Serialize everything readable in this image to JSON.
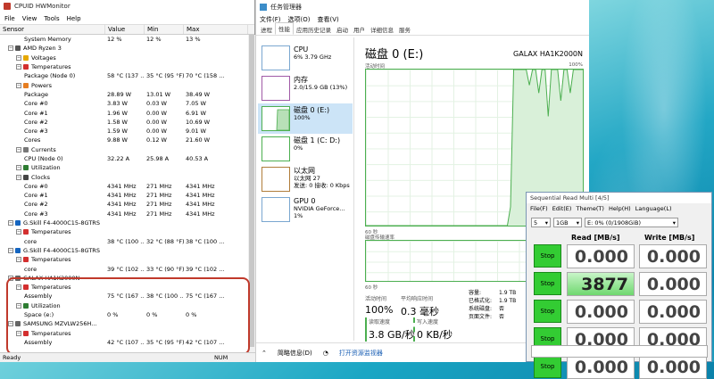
{
  "hwmonitor": {
    "title": "CPUID HWMonitor",
    "menu": [
      "File",
      "View",
      "Tools",
      "Help"
    ],
    "columns": [
      "Sensor",
      "Value",
      "Min",
      "Max"
    ],
    "rows": [
      {
        "indent": 3,
        "label": "System Memory",
        "value": "12 %",
        "min": "12 %",
        "max": "13 %"
      },
      {
        "indent": 1,
        "label": "AMD Ryzen 3",
        "icon": "chip",
        "value": "",
        "min": "",
        "max": ""
      },
      {
        "indent": 2,
        "label": "Voltages",
        "icon": "volt",
        "value": "",
        "min": "",
        "max": ""
      },
      {
        "indent": 2,
        "label": "Temperatures",
        "icon": "temp",
        "value": "",
        "min": "",
        "max": ""
      },
      {
        "indent": 3,
        "label": "Package (Node 0)",
        "value": "58 °C (137 ...",
        "min": "35 °C (95 °F)",
        "max": "70 °C (158 ..."
      },
      {
        "indent": 2,
        "label": "Powers",
        "icon": "power",
        "value": "",
        "min": "",
        "max": ""
      },
      {
        "indent": 3,
        "label": "Package",
        "value": "28.89 W",
        "min": "13.01 W",
        "max": "38.49 W"
      },
      {
        "indent": 3,
        "label": "Core #0",
        "value": "3.83 W",
        "min": "0.03 W",
        "max": "7.05 W"
      },
      {
        "indent": 3,
        "label": "Core #1",
        "value": "1.96 W",
        "min": "0.00 W",
        "max": "6.91 W"
      },
      {
        "indent": 3,
        "label": "Core #2",
        "value": "1.58 W",
        "min": "0.00 W",
        "max": "10.69 W"
      },
      {
        "indent": 3,
        "label": "Core #3",
        "value": "1.59 W",
        "min": "0.00 W",
        "max": "9.01 W"
      },
      {
        "indent": 3,
        "label": "Cores",
        "value": "9.88 W",
        "min": "0.12 W",
        "max": "21.60 W"
      },
      {
        "indent": 2,
        "label": "Currents",
        "icon": "current",
        "value": "",
        "min": "",
        "max": ""
      },
      {
        "indent": 3,
        "label": "CPU (Node 0)",
        "value": "32.22 A",
        "min": "25.98 A",
        "max": "40.53 A"
      },
      {
        "indent": 2,
        "label": "Utilization",
        "icon": "util",
        "value": "",
        "min": "",
        "max": ""
      },
      {
        "indent": 2,
        "label": "Clocks",
        "icon": "clock",
        "value": "",
        "min": "",
        "max": ""
      },
      {
        "indent": 3,
        "label": "Core #0",
        "value": "4341 MHz",
        "min": "271 MHz",
        "max": "4341 MHz"
      },
      {
        "indent": 3,
        "label": "Core #1",
        "value": "4341 MHz",
        "min": "271 MHz",
        "max": "4341 MHz"
      },
      {
        "indent": 3,
        "label": "Core #2",
        "value": "4341 MHz",
        "min": "271 MHz",
        "max": "4341 MHz"
      },
      {
        "indent": 3,
        "label": "Core #3",
        "value": "4341 MHz",
        "min": "271 MHz",
        "max": "4341 MHz"
      },
      {
        "indent": 1,
        "label": "G.Skill F4-4000C15-8GTRS",
        "icon": "ram",
        "value": "",
        "min": "",
        "max": ""
      },
      {
        "indent": 2,
        "label": "Temperatures",
        "icon": "temp",
        "value": "",
        "min": "",
        "max": ""
      },
      {
        "indent": 3,
        "label": "core",
        "value": "38 °C (100 ...",
        "min": "32 °C (88 °F)",
        "max": "38 °C (100 ..."
      },
      {
        "indent": 1,
        "label": "G.Skill F4-4000C15-8GTRS",
        "icon": "ram",
        "value": "",
        "min": "",
        "max": ""
      },
      {
        "indent": 2,
        "label": "Temperatures",
        "icon": "temp",
        "value": "",
        "min": "",
        "max": ""
      },
      {
        "indent": 3,
        "label": "core",
        "value": "39 °C (102 ...",
        "min": "33 °C (90 °F)",
        "max": "39 °C (102 ..."
      },
      {
        "indent": 1,
        "label": "GALAX HA1K2000N",
        "icon": "disk",
        "value": "",
        "min": "",
        "max": ""
      },
      {
        "indent": 2,
        "label": "Temperatures",
        "icon": "temp",
        "value": "",
        "min": "",
        "max": ""
      },
      {
        "indent": 3,
        "label": "Assembly",
        "value": "75 °C (167 ...",
        "min": "38 °C (100 ...",
        "max": "75 °C (167 ..."
      },
      {
        "indent": 2,
        "label": "Utilization",
        "icon": "util",
        "value": "",
        "min": "",
        "max": ""
      },
      {
        "indent": 3,
        "label": "Space (e:)",
        "value": "0 %",
        "min": "0 %",
        "max": "0 %"
      },
      {
        "indent": 1,
        "label": "SAMSUNG MZVLW256H...",
        "icon": "disk",
        "value": "",
        "min": "",
        "max": ""
      },
      {
        "indent": 2,
        "label": "Temperatures",
        "icon": "temp",
        "value": "",
        "min": "",
        "max": ""
      },
      {
        "indent": 3,
        "label": "Assembly",
        "value": "42 °C (107 ...",
        "min": "35 °C (95 °F)",
        "max": "42 °C (107 ..."
      }
    ],
    "status_left": "Ready",
    "status_right": "NUM"
  },
  "taskmgr": {
    "title": "任务管理器",
    "menu": [
      "文件(F)",
      "选项(O)",
      "查看(V)"
    ],
    "tabs": [
      "进程",
      "性能",
      "应用历史记录",
      "启动",
      "用户",
      "详细信息",
      "服务"
    ],
    "active_tab": 1,
    "items": [
      {
        "name": "CPU",
        "line1": "6% 3.79 GHz",
        "line2": ""
      },
      {
        "name": "内存",
        "line1": "2.0/15.9 GB (13%)",
        "line2": ""
      },
      {
        "name": "磁盘 0 (E:)",
        "line1": "100%",
        "line2": ""
      },
      {
        "name": "磁盘 1 (C: D:)",
        "line1": "0%",
        "line2": ""
      },
      {
        "name": "以太网",
        "line1": "以太网 27",
        "line2": "发送: 0 接收: 0 Kbps"
      },
      {
        "name": "GPU 0",
        "line1": "NVIDIA GeForce...",
        "line2": "1%"
      }
    ],
    "disk_title": "磁盘 0 (E:)",
    "disk_model": "GALAX HA1K2000N",
    "graph1_label": "活动时间",
    "graph1_max": "100%",
    "graph1_time": "60 秒",
    "graph2_label": "磁盘传输速率",
    "graph2_time": "60 秒",
    "activity": [
      0,
      0,
      0,
      0,
      0,
      0,
      0,
      0,
      0,
      0,
      0,
      0,
      0,
      0,
      0,
      0,
      0,
      0,
      0,
      0,
      0,
      0,
      0,
      0,
      0,
      0,
      0,
      0,
      0,
      0,
      0,
      0,
      0,
      0,
      0,
      0,
      0,
      0,
      0,
      0,
      0,
      0,
      0,
      0,
      0,
      0,
      12,
      100,
      100,
      100,
      100,
      100,
      90,
      100,
      100,
      85,
      100,
      100,
      70,
      100,
      100,
      100,
      80,
      100,
      100,
      85,
      100,
      100,
      100,
      100
    ],
    "stats": {
      "active_time_label": "活动时间",
      "active_time": "100%",
      "resp_label": "平均响应时间",
      "resp": "0.3 毫秒",
      "read_label": "读取速度",
      "read": "3.8 GB/秒",
      "write_label": "写入速度",
      "write": "0 KB/秒",
      "cap_label": "容量:",
      "cap": "1.9 TB",
      "fmt_label": "已格式化:",
      "fmt": "1.9 TB",
      "sys_label": "系统磁盘:",
      "sys": "否",
      "page_label": "页面文件:",
      "page": "否"
    },
    "footer_brief": "简略信息(D)",
    "footer_link": "打开资源监视器"
  },
  "seqread": {
    "title": "Sequential Read Multi [4/5]",
    "menu": [
      "File(F)",
      "Edit(E)",
      "Theme(T)",
      "Help(H)",
      "Language(L)"
    ],
    "count": "5",
    "size": "1GB",
    "drive": "E: 0% (0/1908GiB)",
    "read_header": "Read [MB/s]",
    "write_header": "Write [MB/s]",
    "stop_label": "Stop",
    "rows": [
      {
        "read": "0.000",
        "write": "0.000",
        "active": false
      },
      {
        "read": "3877",
        "write": "0.000",
        "active": true
      },
      {
        "read": "0.000",
        "write": "0.000",
        "active": false
      },
      {
        "read": "0.000",
        "write": "0.000",
        "active": false
      },
      {
        "read": "0.000",
        "write": "0.000",
        "active": false
      }
    ]
  }
}
